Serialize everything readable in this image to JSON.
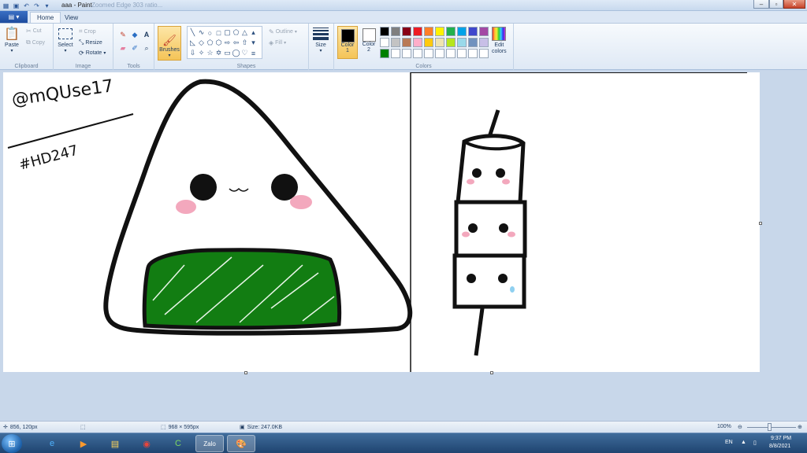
{
  "window": {
    "title": "aaa - Paint",
    "title_faded": "Zoomed Edge 303 ratio...",
    "controls": [
      "minimize",
      "maximize",
      "close"
    ]
  },
  "tabs": {
    "file_label": "",
    "items": [
      {
        "label": "Home",
        "active": true
      },
      {
        "label": "View",
        "active": false
      }
    ]
  },
  "ribbon": {
    "clipboard": {
      "label": "Clipboard",
      "paste": "Paste",
      "cut": "Cut",
      "copy": "Copy"
    },
    "image": {
      "label": "Image",
      "select": "Select",
      "crop": "Crop",
      "resize": "Resize",
      "rotate": "Rotate"
    },
    "tools": {
      "label": "Tools"
    },
    "brushes": {
      "label": "Brushes"
    },
    "shapes": {
      "label": "Shapes",
      "outline": "Outline",
      "fill": "Fill"
    },
    "size": {
      "label": "Size"
    },
    "colors": {
      "label": "Colors",
      "color1": {
        "label": "Color",
        "num": "1",
        "value": "#000000"
      },
      "color2": {
        "label": "Color",
        "num": "2",
        "value": "#ffffff"
      },
      "edit_label": "Edit",
      "edit_label2": "colors",
      "palette_row1": [
        "#000000",
        "#7f7f7f",
        "#880015",
        "#ed1c24",
        "#ff7f27",
        "#fff200",
        "#22b14c",
        "#00a2e8",
        "#3f48cc",
        "#a349a4"
      ],
      "palette_row2": [
        "#ffffff",
        "#c3c3c3",
        "#b97a57",
        "#ffaec9",
        "#ffc90e",
        "#efe4b0",
        "#b5e61d",
        "#99d9ea",
        "#7092be",
        "#c8bfe7"
      ],
      "palette_row3": [
        "#008000",
        "#ffffff",
        "#ffffff",
        "#ffffff",
        "#ffffff",
        "#ffffff",
        "#ffffff",
        "#ffffff",
        "#ffffff",
        "#ffffff"
      ]
    }
  },
  "canvas": {
    "handwriting_name": "@mQUse17",
    "handwriting_tag": "#HD247"
  },
  "statusbar": {
    "cursor_pos": "856, 120px",
    "canvas_size": "968 × 595px",
    "file_size": "Size: 247.0KB",
    "zoom": "100%"
  },
  "taskbar": {
    "apps": [
      {
        "name": "ie-icon",
        "glyph": "e",
        "color": "#4fb3ff"
      },
      {
        "name": "media-player-icon",
        "glyph": "▶",
        "color": "#ff9a2e"
      },
      {
        "name": "file-explorer-icon",
        "glyph": "▤",
        "color": "#ffd65a"
      },
      {
        "name": "chrome-icon",
        "glyph": "◉",
        "color": "#e8453c"
      },
      {
        "name": "cococ-icon",
        "glyph": "C",
        "color": "#7fd860"
      },
      {
        "name": "zalo-icon",
        "glyph": "Zalo",
        "color": "#ffffff"
      },
      {
        "name": "paint-icon",
        "glyph": "🎨",
        "color": "#ffffff"
      }
    ],
    "lang": "EN",
    "time": "9:37 PM",
    "date": "8/8/2021"
  }
}
